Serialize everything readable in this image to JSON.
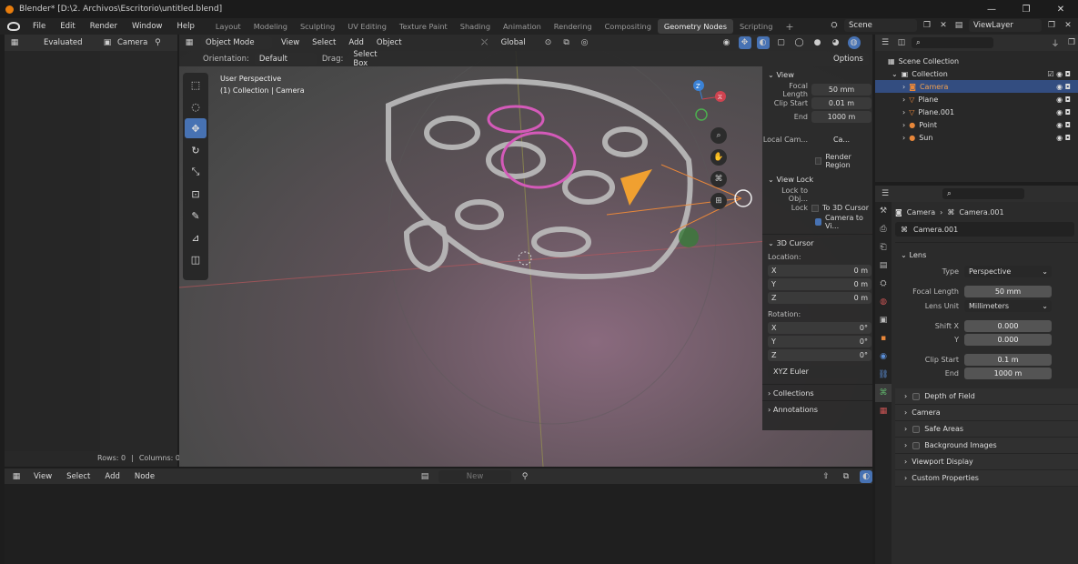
{
  "window": {
    "title": "Blender* [D:\\2. Archivos\\Escritorio\\untitled.blend]",
    "min": "—",
    "max": "❐",
    "close": "✕"
  },
  "menu": [
    "File",
    "Edit",
    "Render",
    "Window",
    "Help"
  ],
  "workspaces": [
    "Layout",
    "Modeling",
    "Sculpting",
    "UV Editing",
    "Texture Paint",
    "Shading",
    "Animation",
    "Rendering",
    "Compositing",
    "Geometry Nodes",
    "Scripting"
  ],
  "workspace_add": "+",
  "scene": {
    "value": "Scene"
  },
  "viewlayer": {
    "value": "ViewLayer"
  },
  "spreadsheet": {
    "evaluated": "Evaluated",
    "object": "Camera",
    "rows": "Rows: 0",
    "columns": "Columns: 0"
  },
  "viewport_header": {
    "mode": "Object Mode",
    "menus": [
      "View",
      "Select",
      "Add",
      "Object"
    ],
    "transform": "Global",
    "options": "Options"
  },
  "viewport_header2": {
    "orientation_label": "Orientation:",
    "orientation": "Default",
    "drag_label": "Drag:",
    "drag": "Select Box"
  },
  "viewport_overlay": {
    "line1": "User Perspective",
    "line2": "(1) Collection | Camera"
  },
  "npanel": {
    "view_title": "View",
    "focal_length_label": "Focal Length",
    "focal_length": "50 mm",
    "clip_start_label": "Clip Start",
    "clip_start": "0.01 m",
    "end_label": "End",
    "end": "1000 m",
    "local_camera_label": "Local Cam...",
    "local_camera_val": "Ca...",
    "render_region": "Render Region",
    "view_lock_title": "View Lock",
    "lock_to_obj_label": "Lock to Obj...",
    "lock_label": "Lock",
    "to_3d_cursor": "To 3D Cursor",
    "camera_to_view": "Camera to Vi...",
    "cursor_title": "3D Cursor",
    "location_label": "Location:",
    "loc": [
      {
        "axis": "X",
        "value": "0 m"
      },
      {
        "axis": "Y",
        "value": "0 m"
      },
      {
        "axis": "Z",
        "value": "0 m"
      }
    ],
    "rotation_label": "Rotation:",
    "rot": [
      {
        "axis": "X",
        "value": "0°"
      },
      {
        "axis": "Y",
        "value": "0°"
      },
      {
        "axis": "Z",
        "value": "0°"
      }
    ],
    "rotation_mode": "XYZ Euler",
    "collections": "Collections",
    "annotations": "Annotations"
  },
  "outliner": {
    "scene_collection": "Scene Collection",
    "items": [
      {
        "name": "Collection"
      },
      {
        "name": "Camera",
        "color": "#e8873a"
      },
      {
        "name": "Plane",
        "color": "#e8873a"
      },
      {
        "name": "Plane.001",
        "color": "#e8873a"
      },
      {
        "name": "Point",
        "color": "#e8873a"
      },
      {
        "name": "Sun",
        "color": "#e8873a"
      }
    ]
  },
  "properties": {
    "breadcrumb_obj": "Camera",
    "breadcrumb_data": "Camera.001",
    "datablock": "Camera.001",
    "lens_title": "Lens",
    "type_label": "Type",
    "type": "Perspective",
    "focal_label": "Focal Length",
    "focal": "50 mm",
    "lens_unit_label": "Lens Unit",
    "lens_unit": "Millimeters",
    "shift_x_label": "Shift X",
    "shift_x": "0.000",
    "shift_y_label": "Y",
    "shift_y": "0.000",
    "clip_start_label": "Clip Start",
    "clip_start": "0.1 m",
    "clip_end_label": "End",
    "clip_end": "1000 m",
    "subpanels": [
      "Depth of Field",
      "Camera",
      "Safe Areas",
      "Background Images",
      "Viewport Display",
      "Custom Properties"
    ]
  },
  "node_editor": {
    "menus": [
      "View",
      "Select",
      "Add",
      "Node"
    ],
    "new": "New"
  },
  "colors": {
    "accent": "#4772b3",
    "selected_row": "#334d80",
    "orange": "#e8873a"
  }
}
